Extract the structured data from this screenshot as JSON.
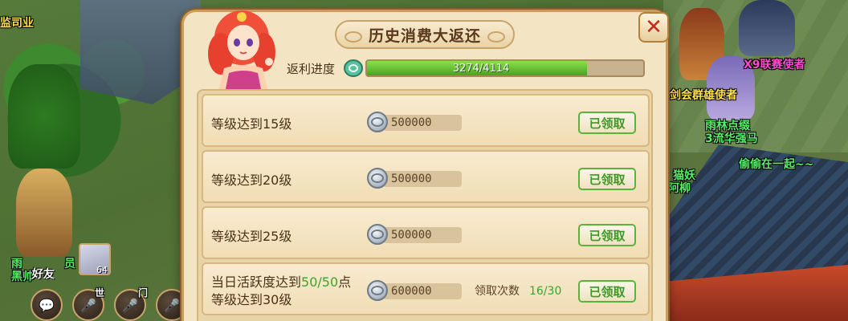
{
  "world": {
    "npc_top_left": "监司业",
    "npc_name_1": "X9联赛使者",
    "npc_name_2": "剑会群雄使者",
    "npc_name_3": "雨林点缀",
    "npc_name_4": "3流华强马",
    "npc_name_5": "偷偷在一起~~",
    "npc_name_6": "猫妖",
    "npc_name_7": "阿柳",
    "npc_name_8": "雨",
    "npc_name_9": "员",
    "npc_name_10": "黑帅",
    "friend_label": "好友",
    "avatar_level": "64",
    "chat_labels": [
      "世",
      "门"
    ]
  },
  "dialog": {
    "title": "历史消费大返还",
    "close_icon": "close-x-icon",
    "progress": {
      "label": "返利进度",
      "current": 3274,
      "total": 4114,
      "text": "3274/4114",
      "fraction": 0.7958
    },
    "rows": [
      {
        "condition": "等级达到15级",
        "amount": "500000",
        "button": "已领取"
      },
      {
        "condition": "等级达到20级",
        "amount": "500000",
        "button": "已领取"
      },
      {
        "condition": "等级达到25级",
        "amount": "500000",
        "button": "已领取"
      },
      {
        "condition_line1_prefix": "当日活跃度达到",
        "condition_line1_highlight": "50/50",
        "condition_line1_suffix": "点",
        "condition_line2": "等级达到30级",
        "amount": "600000",
        "claim_label": "领取次数",
        "claim_value": "16/30",
        "button": "已领取"
      }
    ]
  },
  "colors": {
    "accent_green": "#3aa52a",
    "close_red": "#c62a1a",
    "panel_bg": "#f3e4c4"
  }
}
